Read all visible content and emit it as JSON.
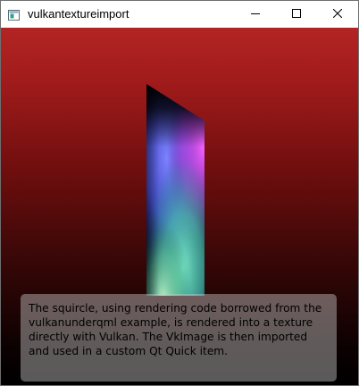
{
  "window": {
    "title": "vulkantextureimport",
    "app_icon": "qt-app-icon",
    "buttons": {
      "minimize": "minimize-icon",
      "maximize": "maximize-icon",
      "close": "close-icon"
    }
  },
  "scene": {
    "background_colors": [
      "#b32424",
      "#000000"
    ],
    "description_text": "The squircle, using rendering code borrowed from the vulkanunderqml example, is rendered into a texture directly with Vulkan. The VkImage is then imported and used in a custom Qt Quick item."
  }
}
